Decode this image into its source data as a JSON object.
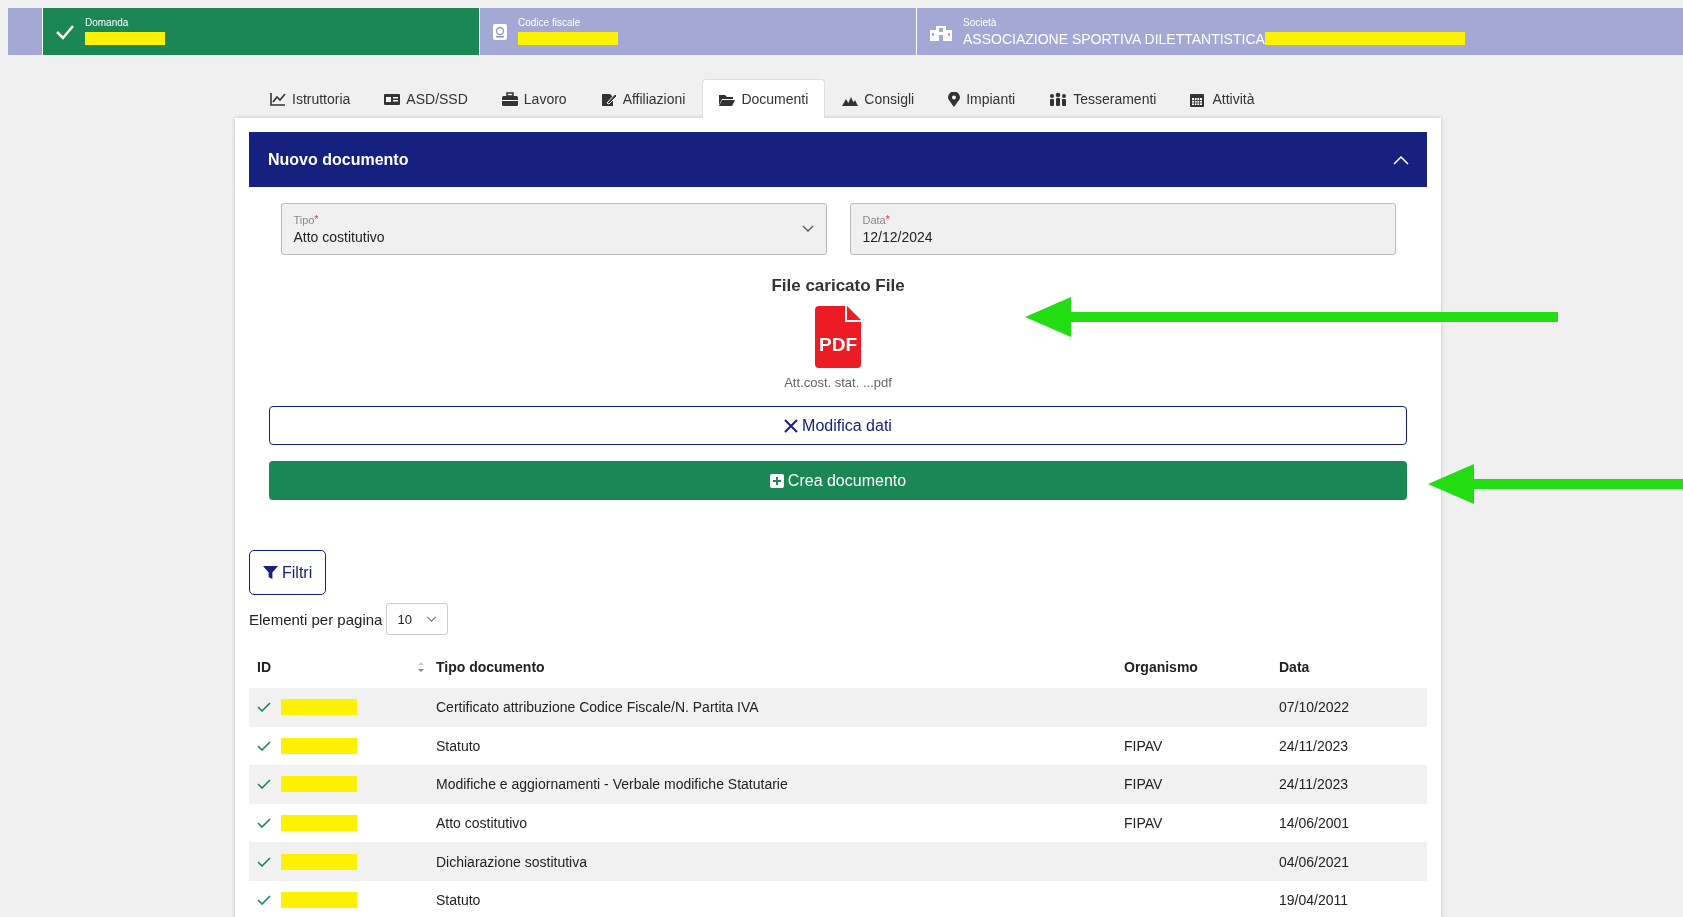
{
  "steps": [
    {
      "label": "Domanda",
      "completed": true,
      "redacted": true
    },
    {
      "label": "Codice fiscale",
      "completed": false,
      "redacted": true
    },
    {
      "label": "Società",
      "completed": false,
      "value": "ASSOCIAZIONE SPORTIVA DILETTANTISTICA",
      "redacted": true
    }
  ],
  "tabs": [
    {
      "label": "Istruttoria",
      "selected": false
    },
    {
      "label": "ASD/SSD",
      "selected": false
    },
    {
      "label": "Lavoro",
      "selected": false
    },
    {
      "label": "Affiliazioni",
      "selected": false
    },
    {
      "label": "Documenti",
      "selected": true
    },
    {
      "label": "Consigli",
      "selected": false
    },
    {
      "label": "Impianti",
      "selected": false
    },
    {
      "label": "Tesseramenti",
      "selected": false
    },
    {
      "label": "Attività",
      "selected": false
    }
  ],
  "panel": {
    "title": "Nuovo documento",
    "expanded": true,
    "fields": [
      {
        "kind": "select",
        "label": "Tipo",
        "required_mark": "*",
        "value": "Atto costitutivo"
      },
      {
        "kind": "text",
        "label": "Data",
        "required_mark": "*",
        "value": "12/12/2024"
      }
    ],
    "upload": {
      "title": "File caricato File",
      "icon_text": "PDF",
      "file_name": "Att.cost. stat. ...pdf"
    },
    "buttons": [
      {
        "kind": "outline",
        "label": "Modifica dati"
      },
      {
        "kind": "primary",
        "label": "Crea documento"
      }
    ]
  },
  "filter_button": "Filtri",
  "page_size": {
    "label": "Elementi per pagina",
    "value": "10"
  },
  "table": {
    "columns": [
      "ID",
      "Tipo documento",
      "Organismo",
      "Data"
    ],
    "rows": [
      {
        "tipo": "Certificato attribuzione Codice Fiscale/N. Partita IVA",
        "data": "07/10/2022"
      },
      {
        "tipo": "Statuto",
        "organismo": "FIPAV",
        "data": "24/11/2023"
      },
      {
        "tipo": "Modifiche e aggiornamenti - Verbale modifiche Statutarie",
        "organismo": "FIPAV",
        "data": "24/11/2023"
      },
      {
        "tipo": "Atto costitutivo",
        "organismo": "FIPAV",
        "data": "14/06/2001"
      },
      {
        "tipo": "Dichiarazione sostitutiva",
        "data": "04/06/2021"
      },
      {
        "tipo": "Statuto",
        "data": "19/04/2011"
      }
    ]
  },
  "annotations": [
    {
      "kind": "arrow"
    },
    {
      "kind": "arrow"
    }
  ]
}
